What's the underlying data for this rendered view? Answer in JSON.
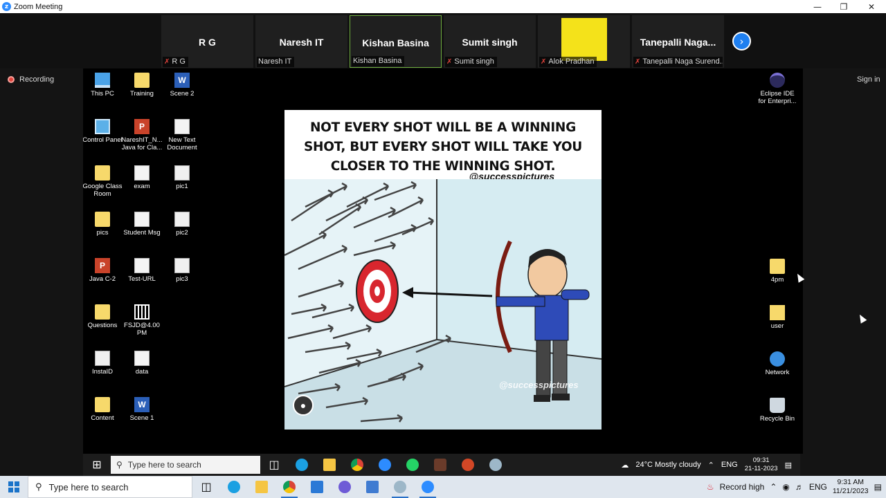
{
  "window": {
    "title": "Zoom Meeting"
  },
  "participants": [
    {
      "display": "R G",
      "label": "R G",
      "muted": true
    },
    {
      "display": "Naresh IT",
      "label": "Naresh IT",
      "muted": false
    },
    {
      "display": "Kishan Basina",
      "label": "Kishan Basina",
      "muted": false,
      "active": true
    },
    {
      "display": "Sumit singh",
      "label": "Sumit singh",
      "muted": true
    },
    {
      "display": "",
      "label": "Alok Pradhan",
      "muted": true,
      "video_color": "#f4e21a"
    },
    {
      "display": "Tanepalli  Naga...",
      "label": "Tanepalli Naga Surend...",
      "muted": true
    }
  ],
  "meeting": {
    "recording_label": "Recording",
    "signin_label": "Sign in"
  },
  "desktop": {
    "left_icons": [
      {
        "label": "This PC",
        "icon": "computer-icon"
      },
      {
        "label": "Training",
        "icon": "folder-icon"
      },
      {
        "label": "Scene 2",
        "icon": "word-icon"
      },
      {
        "label": "Control Panel",
        "icon": "control-panel-icon"
      },
      {
        "label": "NareshIT_N... Java for Cla...",
        "icon": "powerpoint-icon"
      },
      {
        "label": "New Text Document",
        "icon": "text-document-icon"
      },
      {
        "label": "Google Class Room",
        "icon": "folder-icon"
      },
      {
        "label": "exam",
        "icon": "text-document-icon"
      },
      {
        "label": "pic1",
        "icon": "image-icon"
      },
      {
        "label": "pics",
        "icon": "folder-icon"
      },
      {
        "label": "Student Msg",
        "icon": "text-document-icon"
      },
      {
        "label": "pic2",
        "icon": "image-icon"
      },
      {
        "label": "Java C-2",
        "icon": "powerpoint-icon"
      },
      {
        "label": "Test-URL",
        "icon": "text-document-icon"
      },
      {
        "label": "pic3",
        "icon": "image-icon"
      },
      {
        "label": "Questions",
        "icon": "folder-icon"
      },
      {
        "label": "FSJD@4.00 PM",
        "icon": "qr-image-icon"
      },
      {
        "label": "InstaID",
        "icon": "image-icon"
      },
      {
        "label": "data",
        "icon": "text-document-icon"
      },
      {
        "label": "Content",
        "icon": "folder-icon"
      },
      {
        "label": "Scene 1",
        "icon": "word-icon"
      }
    ],
    "right_icons": [
      {
        "label": "Eclipse IDE for Enterpri...",
        "icon": "eclipse-icon"
      },
      {
        "label": "4pm",
        "icon": "folder-icon"
      },
      {
        "label": "user",
        "icon": "user-folder-icon"
      },
      {
        "label": "Network",
        "icon": "network-icon"
      },
      {
        "label": "Recycle Bin",
        "icon": "recycle-bin-icon"
      }
    ],
    "taskbar": {
      "search_placeholder": "Type here to search",
      "weather": "24°C  Mostly cloudy",
      "lang": "ENG",
      "time": "09:31",
      "date": "21-11-2023"
    }
  },
  "slide": {
    "quote_lines": [
      "NOT EVERY SHOT WILL BE A WINNING",
      "SHOT, BUT EVERY SHOT WILL TAKE YOU",
      "CLOSER TO THE WINNING SHOT."
    ],
    "handle": "@successpictures",
    "watermark": "@successpictures"
  },
  "taskbar": {
    "search_placeholder": "Type here to search",
    "record_label": "Record high",
    "lang": "ENG",
    "time": "9:31 AM",
    "date": "11/21/2023"
  },
  "colors": {
    "zoom_blue": "#2D8CFF",
    "muted_red": "#e0443c",
    "active_border": "#6fae3f"
  }
}
